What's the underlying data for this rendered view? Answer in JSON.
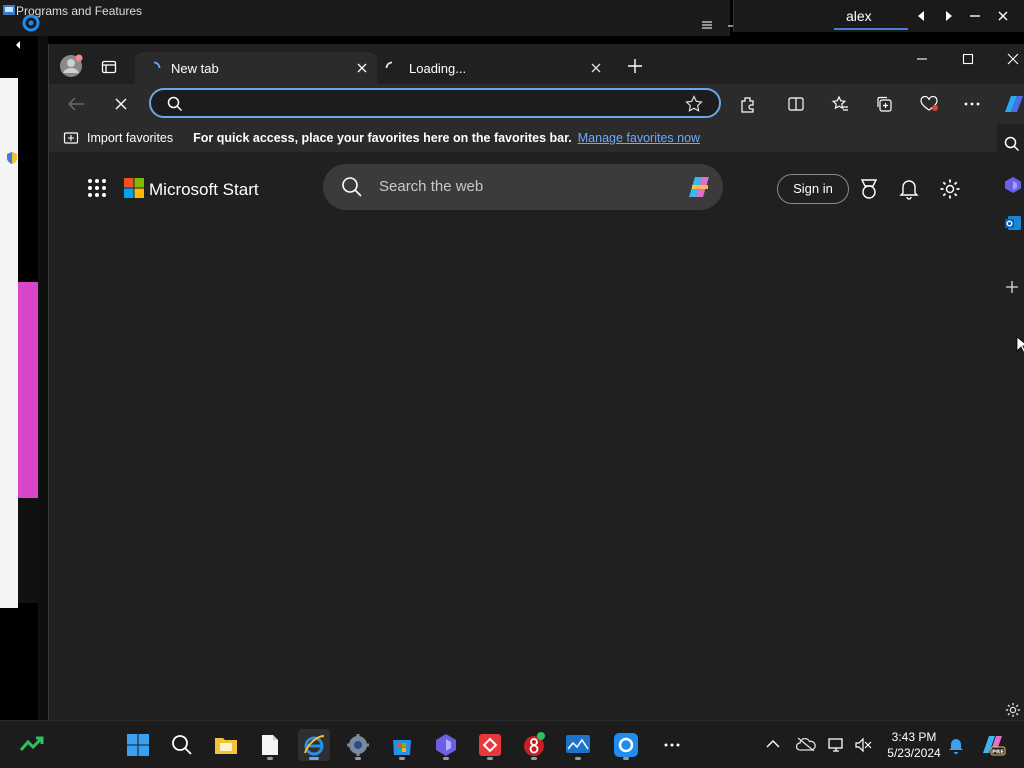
{
  "background": {
    "window_title": "Programs and Features",
    "remote_user": "alex"
  },
  "browser": {
    "tabs": [
      {
        "label": "New tab",
        "active": true
      },
      {
        "label": "Loading...",
        "active": false
      }
    ],
    "address_value": "",
    "favorites_bar": {
      "import_label": "Import favorites",
      "hint": "For quick access, place your favorites here on the favorites bar.",
      "manage_link": "Manage favorites now"
    },
    "page": {
      "brand": "Microsoft Start",
      "search_placeholder": "Search the web",
      "signin_label": "Sign in"
    }
  },
  "taskbar": {
    "time": "3:43 PM",
    "date": "5/23/2024"
  },
  "colors": {
    "accent_link": "#6ea8fe",
    "address_focus": "#6aa7e8",
    "bg_pink": "#d845c9"
  }
}
